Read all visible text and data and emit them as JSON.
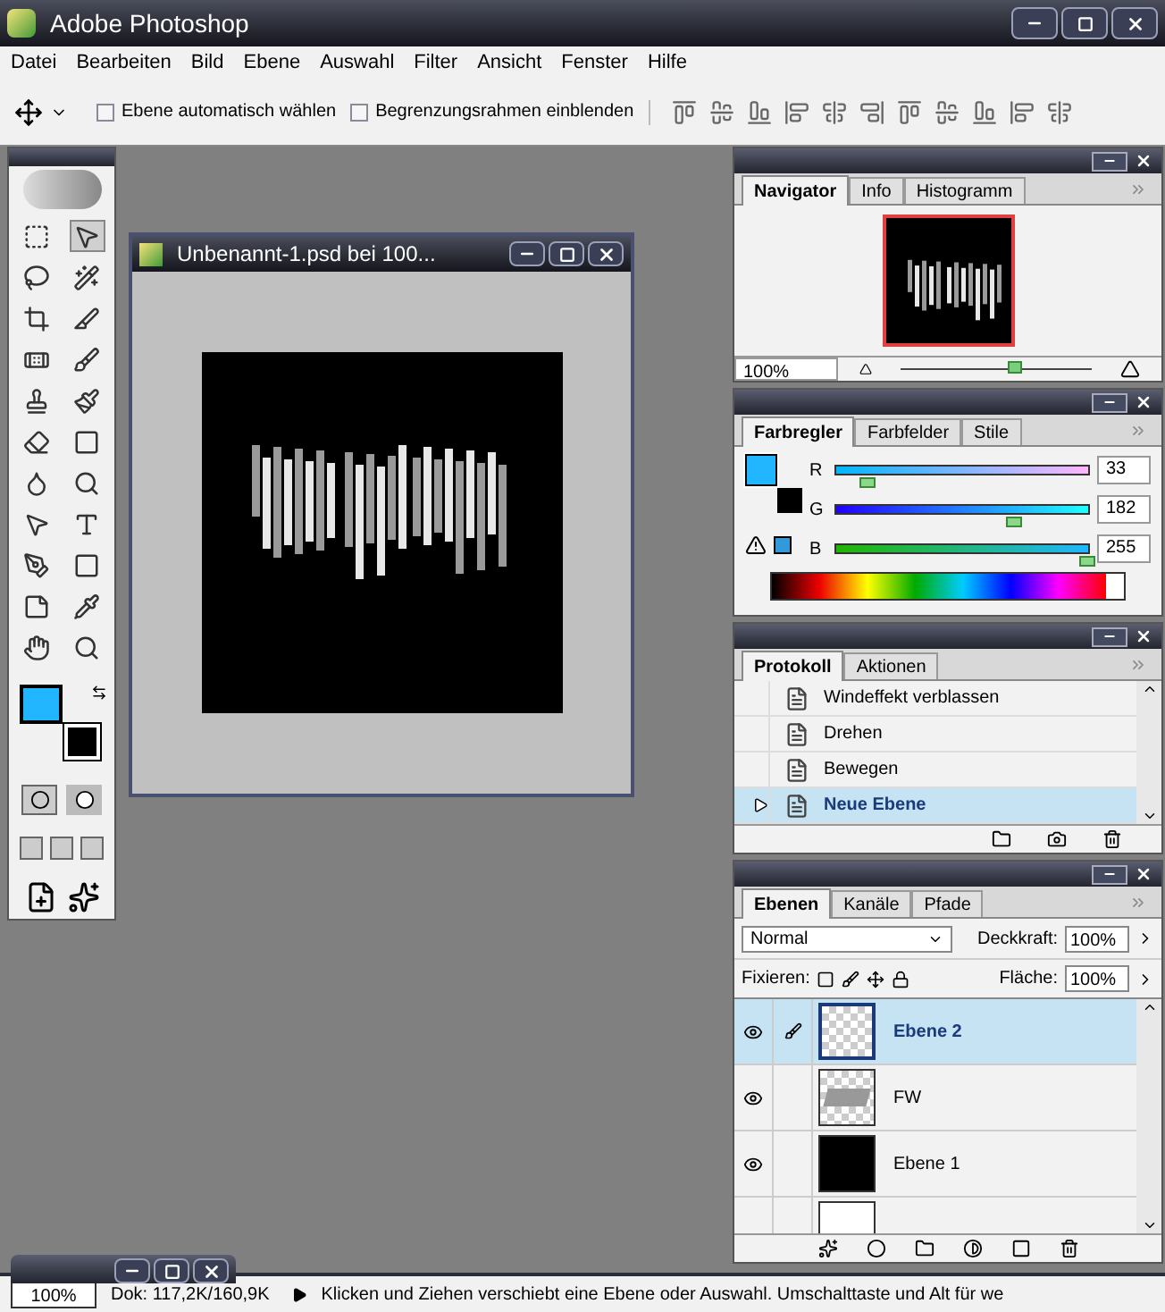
{
  "window": {
    "title": "Adobe Photoshop"
  },
  "menu": [
    "Datei",
    "Bearbeiten",
    "Bild",
    "Ebene",
    "Auswahl",
    "Filter",
    "Ansicht",
    "Fenster",
    "Hilfe"
  ],
  "options_bar": {
    "checkboxes": [
      {
        "label": "Ebene automatisch wählen",
        "checked": false
      },
      {
        "label": "Begrenzungsrahmen einblenden",
        "checked": false
      }
    ]
  },
  "document": {
    "title": "Unbenannt-1.psd bei 100..."
  },
  "navigator": {
    "tabs": [
      {
        "label": "Navigator",
        "selected": true
      },
      {
        "label": "Info",
        "selected": false
      },
      {
        "label": "Histogramm",
        "selected": false
      }
    ],
    "zoom": "100%",
    "level": 0.6
  },
  "color": {
    "tabs": [
      {
        "label": "Farbregler",
        "selected": true
      },
      {
        "label": "Farbfelder",
        "selected": false
      },
      {
        "label": "Stile",
        "selected": false
      }
    ],
    "channels": [
      {
        "label": "R",
        "value": "33",
        "level": 0.13
      },
      {
        "label": "G",
        "value": "182",
        "level": 0.71
      },
      {
        "label": "B",
        "value": "255",
        "level": 1
      }
    ],
    "swatches": [
      {
        "kind": "foreground",
        "color": "#21b6ff"
      },
      {
        "kind": "background",
        "color": "#000000"
      }
    ]
  },
  "history": {
    "tabs": [
      {
        "label": "Protokoll",
        "selected": true
      },
      {
        "label": "Aktionen",
        "selected": false
      }
    ],
    "items": [
      {
        "label": "Windeffekt verblassen",
        "selected": false
      },
      {
        "label": "Drehen",
        "selected": false
      },
      {
        "label": "Bewegen",
        "selected": false
      },
      {
        "label": "Neue Ebene",
        "selected": true
      }
    ]
  },
  "layers": {
    "tabs": [
      {
        "label": "Ebenen",
        "selected": true
      },
      {
        "label": "Kanäle",
        "selected": false
      },
      {
        "label": "Pfade",
        "selected": false
      }
    ],
    "blend_mode": "Normal",
    "opacity_label": "Deckkraft:",
    "opacity": "100%",
    "lock_label": "Fixieren:",
    "fill_label": "Fläche:",
    "fill": "100%",
    "items": [
      {
        "name": "Ebene 2",
        "kind": "transparent",
        "visible": true,
        "selected": true
      },
      {
        "name": "FW",
        "kind": "text",
        "visible": true,
        "selected": false
      },
      {
        "name": "Ebene 1",
        "kind": "black",
        "visible": true,
        "selected": false
      },
      {
        "kind": "white",
        "visible": false,
        "selected": false
      }
    ]
  },
  "status_bar": {
    "zoom": "100%",
    "doc": "Dok: 117,2K/160,9K",
    "hint": "Klicken und Ziehen verschiebt eine Ebene oder Auswahl. Umschalttaste und Alt für we"
  }
}
